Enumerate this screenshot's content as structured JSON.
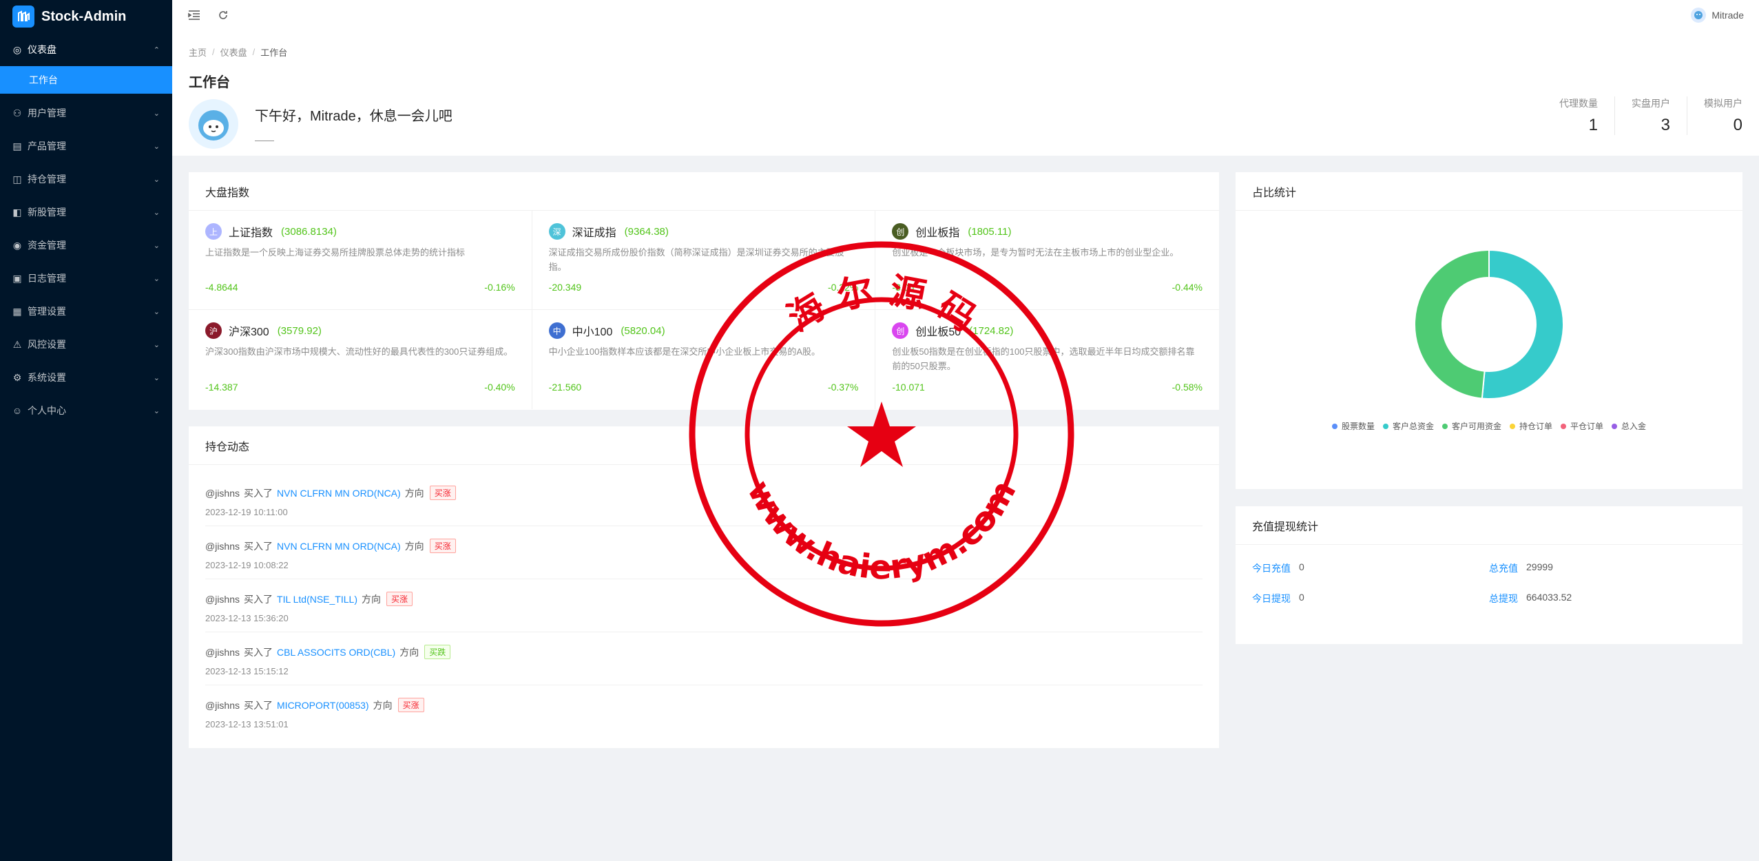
{
  "app": {
    "name": "Stock-Admin"
  },
  "sidebar": {
    "items": [
      {
        "label": "仪表盘",
        "icon": "dashboard-icon",
        "open": true,
        "children": [
          {
            "label": "工作台",
            "active": true
          }
        ]
      },
      {
        "label": "用户管理",
        "icon": "user-manage-icon"
      },
      {
        "label": "产品管理",
        "icon": "product-icon"
      },
      {
        "label": "持仓管理",
        "icon": "position-icon"
      },
      {
        "label": "新股管理",
        "icon": "ipo-icon"
      },
      {
        "label": "资金管理",
        "icon": "money-icon"
      },
      {
        "label": "日志管理",
        "icon": "log-icon"
      },
      {
        "label": "管理设置",
        "icon": "admin-settings-icon"
      },
      {
        "label": "风控设置",
        "icon": "risk-icon"
      },
      {
        "label": "系统设置",
        "icon": "system-settings-icon"
      },
      {
        "label": "个人中心",
        "icon": "personal-icon"
      }
    ]
  },
  "header": {
    "username": "Mitrade"
  },
  "breadcrumb": [
    "主页",
    "仪表盘",
    "工作台"
  ],
  "page": {
    "title": "工作台",
    "greeting": "下午好，Mitrade，休息一会儿吧",
    "greeting_sub": "——"
  },
  "stats": [
    {
      "label": "代理数量",
      "value": "1"
    },
    {
      "label": "实盘用户",
      "value": "3"
    },
    {
      "label": "模拟用户",
      "value": "0"
    }
  ],
  "market": {
    "title": "大盘指数",
    "indices": [
      {
        "badge": "上",
        "badge_color": "#adb5ff",
        "name": "上证指数",
        "value": "(3086.8134)",
        "desc": "上证指数是一个反映上海证券交易所挂牌股票总体走势的统计指标",
        "change": "-4.8644",
        "pct": "-0.16%"
      },
      {
        "badge": "深",
        "badge_color": "#4fc3d9",
        "name": "深证成指",
        "value": "(9364.38)",
        "desc": "深证成指交易所成份股价指数（简称深证成指）是深圳证券交易所的主要股指。",
        "change": "-20.349",
        "pct": "-0.22%"
      },
      {
        "badge": "创",
        "badge_color": "#4a5d23",
        "name": "创业板指",
        "value": "(1805.11)",
        "desc": "创业板是一个板块市场，是专为暂时无法在主板市场上市的创业型企业。",
        "change": "-8.05",
        "pct": "-0.44%"
      },
      {
        "badge": "沪",
        "badge_color": "#8b1a2b",
        "name": "沪深300",
        "value": "(3579.92)",
        "desc": "沪深300指数由沪深市场中规模大、流动性好的最具代表性的300只证券组成。",
        "change": "-14.387",
        "pct": "-0.40%"
      },
      {
        "badge": "中",
        "badge_color": "#3f6fd1",
        "name": "中小100",
        "value": "(5820.04)",
        "desc": "中小企业100指数样本应该都是在深交所中小企业板上市交易的A股。",
        "change": "-21.560",
        "pct": "-0.37%"
      },
      {
        "badge": "创",
        "badge_color": "#d946ef",
        "name": "创业板50",
        "value": "(1724.82)",
        "desc": "创业板50指数是在创业板指的100只股票中，选取最近半年日均成交额排名靠前的50只股票。",
        "change": "-10.071",
        "pct": "-0.58%"
      }
    ]
  },
  "positions": {
    "title": "持仓动态",
    "items": [
      {
        "user": "@jishns",
        "action": "买入了",
        "stock": "NVN CLFRN MN ORD(NCA)",
        "dir_label": "方向",
        "tag": "买涨",
        "tag_type": "red",
        "time": "2023-12-19 10:11:00"
      },
      {
        "user": "@jishns",
        "action": "买入了",
        "stock": "NVN CLFRN MN ORD(NCA)",
        "dir_label": "方向",
        "tag": "买涨",
        "tag_type": "red",
        "time": "2023-12-19 10:08:22"
      },
      {
        "user": "@jishns",
        "action": "买入了",
        "stock": "TIL Ltd(NSE_TILL)",
        "dir_label": "方向",
        "tag": "买涨",
        "tag_type": "red",
        "time": "2023-12-13 15:36:20"
      },
      {
        "user": "@jishns",
        "action": "买入了",
        "stock": "CBL ASSOCITS ORD(CBL)",
        "dir_label": "方向",
        "tag": "买跌",
        "tag_type": "green",
        "time": "2023-12-13 15:15:12"
      },
      {
        "user": "@jishns",
        "action": "买入了",
        "stock": "MICROPORT(00853)",
        "dir_label": "方向",
        "tag": "买涨",
        "tag_type": "red",
        "time": "2023-12-13 13:51:01"
      }
    ]
  },
  "ratio": {
    "title": "占比统计",
    "chart_data": {
      "type": "pie",
      "donut": true,
      "slices": [
        {
          "name": "股票数量",
          "value": 0,
          "color": "#5b8ff9"
        },
        {
          "name": "客户总资金",
          "value": 51.5,
          "color": "#36cbcb"
        },
        {
          "name": "客户可用资金",
          "value": 48.5,
          "color": "#4ecb73"
        },
        {
          "name": "持仓订单",
          "value": 0,
          "color": "#fbd437"
        },
        {
          "name": "平仓订单",
          "value": 0,
          "color": "#f2637b"
        },
        {
          "name": "总入金",
          "value": 0,
          "color": "#975fe5"
        }
      ]
    }
  },
  "recharge": {
    "title": "充值提现统计",
    "rows": [
      [
        {
          "k": "今日充值",
          "v": "0"
        },
        {
          "k": "总充值",
          "v": "29999"
        }
      ],
      [
        {
          "k": "今日提现",
          "v": "0"
        },
        {
          "k": "总提现",
          "v": "664033.52"
        }
      ]
    ]
  },
  "watermark": {
    "top_text": "海 尔 源 码",
    "bottom_text": "www.haierym.com",
    "color": "#e60012"
  }
}
